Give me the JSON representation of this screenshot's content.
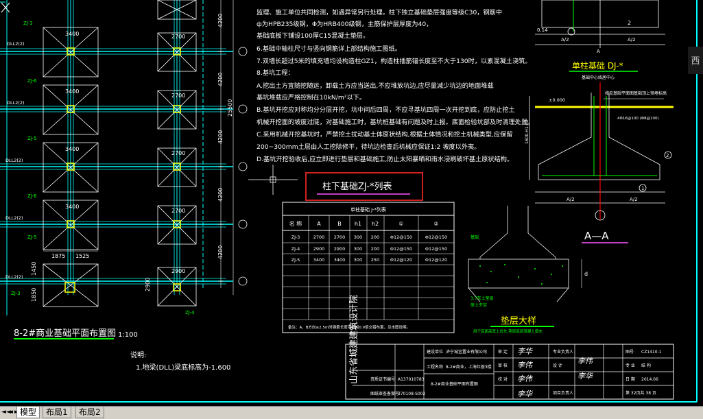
{
  "drawing": {
    "notes_lines": [
      "监理、施工单位共同检测，如遇异常另行处理。柱下独立基础垫层强度等级C30，钢筋中",
      "ф为HPB235级钢，Φ为HRB400级钢，主筋保护层厚度为40，",
      "基础底板下铺设100厚C15混凝土垫层。",
      "6.基础中轴柱尺寸与竖向钢筋详上部结构施工图纸。",
      "7.双墙长超过5米的填充墙均设构造柱GZ1，构造柱插筋锚长度至不大于130时，以素混凝土浇筑。",
      "8.基坑工程：",
      "A.挖出土方宜随挖随运，卸载土方应当送出,不应堆放坑边,应尽量减少坑边的地面堆载",
      "   基坑堆载应严格控制在10kN/m²以下。",
      "B.基坑开挖应对称均分分层开挖，坑中间后四周，不应寻基坑四周一次开挖到底，应防止挖土",
      "   机械开挖面的坡度过陡，对基础施工时，基坑桩基础有问题及时上报。底面检验坑部及时清理处置。",
      "C.采用机械开挖基坑时，严禁挖土扰动基土体原状结构,根据土体情况和挖土机械类型,应保留",
      "   200~300mm土层由人工挖除修平，待坑边检查后机械应保证1:2 坡度以外夷。",
      "D.基坑开挖验收后,应立即进行垫层和基础施工,防止太阳暴晒和雨水浸刷破坏基土原状结构。"
    ],
    "plan_dims_top": [
      "3400",
      "2700"
    ],
    "plan_dims_mid": [
      "3400",
      "2700",
      "3400",
      "2700",
      "3400",
      "2700"
    ],
    "plan_dims_right": [
      "4200",
      "4200",
      "25500",
      "4200",
      "4200",
      "4200"
    ],
    "plan_dims_bottom": [
      "1875",
      "1525",
      "2900",
      "1850",
      "1450",
      "2900"
    ],
    "zj_labels": [
      "ZJ-3",
      "ZJ-6",
      "ZJ-5",
      "ZJ-6",
      "ZJ-5",
      "ZJ-4",
      "ZJ-3"
    ],
    "dll_labels": [
      "DLL2(2)",
      "DLL2(2)",
      "DLL2(2)",
      "DLL2(2)",
      "DLL2(2)"
    ],
    "plan_title": "8-2#商业基础平面布置图",
    "plan_scale": "1:100",
    "legend_title": "说明:",
    "legend_line": "1.地梁(DLL)梁底标高为-1.600",
    "table_heading": "柱下基础ZJ-*列表",
    "table": {
      "caption": "单柱基础 J-*列表",
      "headers": [
        "名 称",
        "A",
        "B",
        "h1",
        "h2",
        "①",
        "②"
      ],
      "rows": [
        [
          "ZJ-3",
          "2700",
          "2700",
          "300",
          "200",
          "Φ12@150",
          "Φ12@150"
        ],
        [
          "ZJ-4",
          "2900",
          "2900",
          "300",
          "200",
          "Φ12@150",
          "Φ12@150"
        ],
        [
          "ZJ-5",
          "3400",
          "3400",
          "300",
          "250",
          "Φ12@120",
          "Φ12@120"
        ]
      ],
      "footnote": "备注：A、B方向≥2.5m时钢筋长度可缩短0.9倍交错布置，见本图说明。"
    },
    "single_foundation_title": "单柱基础 DJ-*",
    "single_foundation_sub": "基础中心线居中心",
    "dims_a2": [
      "A/2",
      "A/2"
    ],
    "dim_top_left": "0.14",
    "dim_a": "A",
    "ground_label": "±0.000",
    "ground_note": "按见基础平面图基础顶上预埋标高",
    "section_note": "4Φ16@100\n(Φ8@100)",
    "section_title": "A—A",
    "pad_title": "垫层大样",
    "pad_sub": "用于底面高宽上优先,垫层底部混凝土填充",
    "pad_labels": [
      "基础",
      "3:7灰土垫层",
      "原土夯实"
    ],
    "pad_d": "d",
    "marker_1": "1",
    "marker_2": "2",
    "marker_2b": "2",
    "dim_1600": "1600-H1-h2",
    "title_block": {
      "institute": "山东省城建建筑设计院",
      "cert_label": "资质证书编号",
      "cert_value": "A137010783",
      "record_label": "图纸审查备案号",
      "record_value": "370108-S002",
      "client_label": "建设单位",
      "client_value": "济宁城宜置业有限公司",
      "project_label": "工程名称",
      "project_value": "8-2#商业，上海红荟3楼",
      "drawing_name": "8-2#商业基础平面布置图",
      "approve_label": "审 定",
      "audit_label": "审 核",
      "check_label": "校 对",
      "design_label": "设 计",
      "resp_label": "专业负责人",
      "proj_lead_label": "项目负责人",
      "drawing_no_label": "图号",
      "drawing_no_value": "CZ1410-1",
      "discipline_label": "专 业",
      "discipline_value": "结 构",
      "date_label": "日 期",
      "date_value": "2014.06",
      "sheet": "第 32页共 38 页",
      "signatures": [
        "李华",
        "李伟"
      ]
    }
  },
  "tabs": [
    "模型",
    "布局1",
    "布局2"
  ],
  "nav_buttons": [
    "◄◄",
    "◄",
    "►",
    "►►"
  ],
  "viewcube_label": "西",
  "colors": {
    "background": "#000000",
    "cyan": "#00ffff",
    "yellow": "#ffff00",
    "green": "#00ff00",
    "white": "#ffffff",
    "red": "#ff0000",
    "magenta": "#c040c0",
    "highlight_box": "#d02020"
  }
}
